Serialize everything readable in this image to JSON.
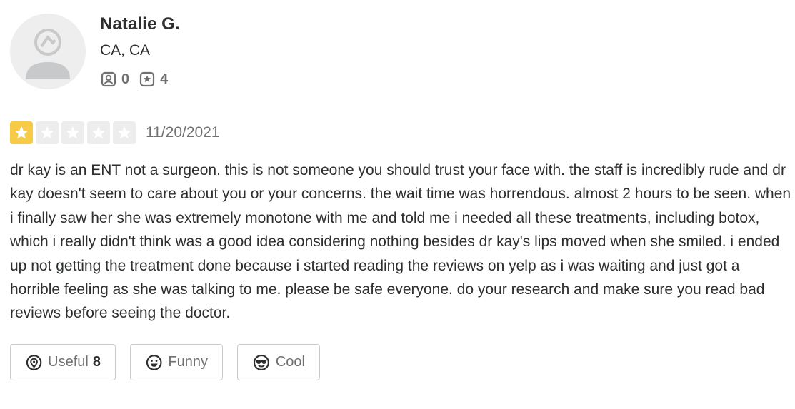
{
  "user": {
    "name": "Natalie G.",
    "location": "CA, CA",
    "friends_count": "0",
    "reviews_count": "4",
    "avatar_icon": "default-avatar-icon"
  },
  "review": {
    "rating": 1,
    "max_rating": 5,
    "star_color": "#f8cb46",
    "date": "11/20/2021",
    "text": "dr kay is an ENT not a surgeon. this is not someone you should trust your face with. the staff is incredibly rude and dr kay doesn't seem to care about you or your concerns. the wait time was horrendous. almost 2 hours to be seen. when i finally saw her she was extremely monotone with me and told me i needed all these treatments, including botox, which i really didn't think was a good idea considering nothing besides dr kay's lips moved when she smiled. i ended up not getting the treatment done because i started reading the reviews on yelp as i was waiting and just got a horrible feeling as she was talking to me. please be safe everyone. do your research and make sure you read bad reviews before seeing the doctor."
  },
  "reactions": {
    "useful_label": "Useful",
    "useful_count": "8",
    "useful_icon": "lightbulb-pin-icon",
    "funny_label": "Funny",
    "funny_icon": "smiley-icon",
    "cool_label": "Cool",
    "cool_icon": "sunglasses-face-icon"
  }
}
